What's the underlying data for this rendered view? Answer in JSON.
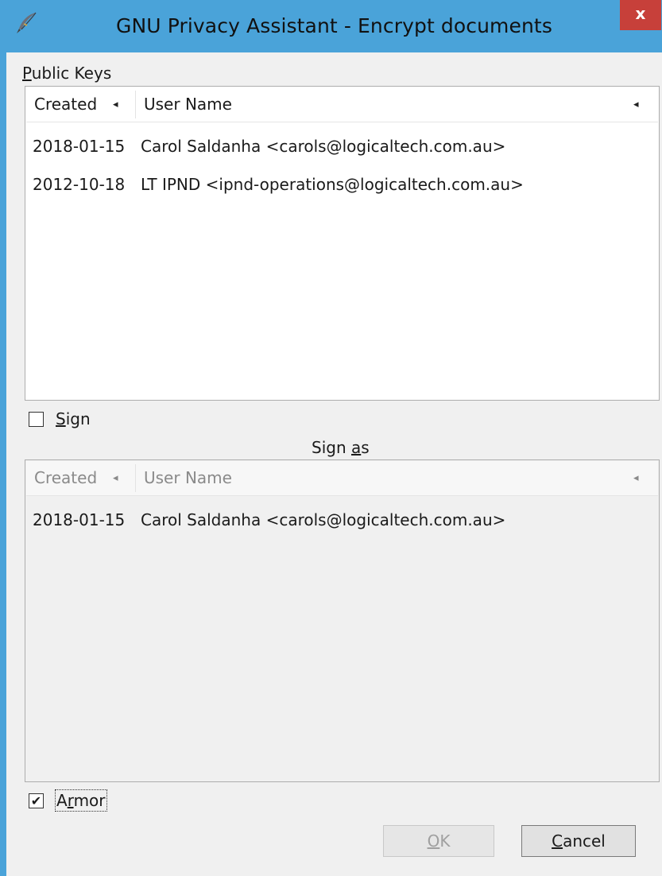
{
  "window": {
    "title": "GNU Privacy Assistant - Encrypt documents",
    "close_glyph": "x",
    "icon": "quill-pen-icon",
    "accent_color": "#4aa3d9",
    "close_color": "#c7403a"
  },
  "public_keys": {
    "label_first": "P",
    "label_rest": "ublic Keys",
    "columns": [
      {
        "label": "Created",
        "sort_glyph": "◂"
      },
      {
        "label": "User Name",
        "sort_glyph": "◂"
      }
    ],
    "rows": [
      {
        "created": "2018-01-15",
        "user": "Carol Saldanha <carols@logicaltech.com.au>"
      },
      {
        "created": "2012-10-18",
        "user": "LT IPND <ipnd-operations@logicaltech.com.au>"
      }
    ]
  },
  "sign": {
    "label_first": "S",
    "label_rest": "ign",
    "checked": false
  },
  "sign_as": {
    "label_before": "Sign ",
    "label_underlined": "a",
    "label_after": "s",
    "columns": [
      {
        "label": "Created",
        "sort_glyph": "◂"
      },
      {
        "label": "User Name",
        "sort_glyph": "◂"
      }
    ],
    "rows": [
      {
        "created": "2018-01-15",
        "user": "Carol Saldanha <carols@logicaltech.com.au>"
      }
    ]
  },
  "armor": {
    "label_before": "A",
    "label_underlined": "r",
    "label_after": "mor",
    "checked": true,
    "check_glyph": "✔"
  },
  "buttons": {
    "ok_underlined": "O",
    "ok_rest": "K",
    "cancel_underlined": "C",
    "cancel_rest": "ancel"
  }
}
